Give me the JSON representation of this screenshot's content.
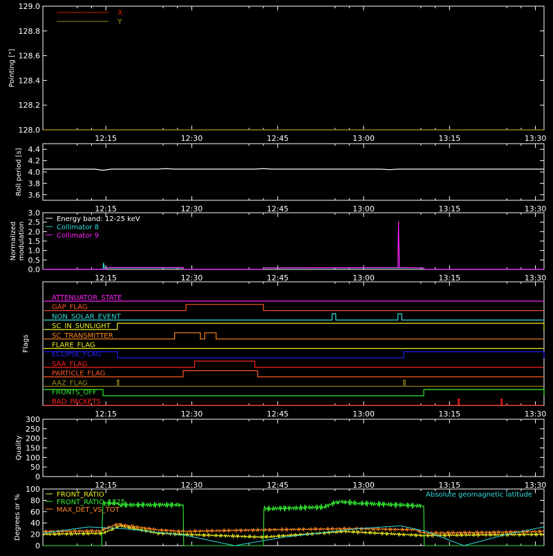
{
  "colors": {
    "background": "#000000",
    "axes": "#ffffff",
    "x_red": "#cc2200",
    "y_olive": "#9a8a20",
    "cyan": "#33dddd",
    "magenta": "#ff22ff",
    "green": "#33ee33",
    "yellow": "#eeee22",
    "orange": "#ff8822"
  },
  "time_axis": {
    "range_minutes": [
      0,
      175
    ],
    "ticks": [
      {
        "label": "12:15",
        "t": 22
      },
      {
        "label": "12:30",
        "t": 52
      },
      {
        "label": "12:45",
        "t": 82
      },
      {
        "label": "13:00",
        "t": 112
      },
      {
        "label": "13:15",
        "t": 142
      },
      {
        "label": "13:30",
        "t": 172
      }
    ]
  },
  "chart_data": [
    {
      "type": "line",
      "ylabel": "Pointing [\"]",
      "ylim": [
        128.0,
        129.0
      ],
      "yticks": [
        "128.0",
        "128.2",
        "128.4",
        "128.6",
        "128.8",
        "129.0"
      ],
      "legend": [
        "X",
        "Y"
      ],
      "series": [
        {
          "name": "X",
          "color": "#cc2200",
          "points": [
            [
              0,
              128.0
            ],
            [
              175,
              128.0
            ]
          ]
        },
        {
          "name": "Y",
          "color": "#9a8a20",
          "points": [
            [
              0,
              128.0
            ],
            [
              175,
              128.0
            ]
          ]
        }
      ]
    },
    {
      "type": "line",
      "ylabel": "Roll period [s]",
      "ylim": [
        3.5,
        4.5
      ],
      "yticks": [
        "3.6",
        "3.8",
        "4.0",
        "4.2",
        "4.4"
      ],
      "series": [
        {
          "color": "#ffffff",
          "points": [
            [
              0,
              4.05
            ],
            [
              18,
              4.05
            ],
            [
              21,
              4.03
            ],
            [
              24,
              4.05
            ],
            [
              40,
              4.05
            ],
            [
              43,
              4.06
            ],
            [
              46,
              4.05
            ],
            [
              74,
              4.05
            ],
            [
              77,
              4.06
            ],
            [
              80,
              4.05
            ],
            [
              118,
              4.05
            ],
            [
              121,
              4.04
            ],
            [
              124,
              4.05
            ],
            [
              175,
              4.05
            ]
          ]
        }
      ]
    },
    {
      "type": "line",
      "ylabel": "Normalized modulation",
      "ylim": [
        0,
        3.0
      ],
      "yticks": [
        "0.0",
        "0.5",
        "1.0",
        "1.5",
        "2.0",
        "2.5",
        "3.0"
      ],
      "legend": [
        "Energy band: 12-25 keV",
        "Collimator 8",
        "Collimator 9"
      ],
      "series": [
        {
          "name": "Collimator 8",
          "color": "#33dddd",
          "points": [
            [
              0,
              0.0
            ],
            [
              21,
              0.0
            ],
            [
              21.2,
              0.35
            ],
            [
              21.5,
              0.05
            ],
            [
              22,
              0.08
            ],
            [
              49,
              0.08
            ],
            [
              49.2,
              0.0
            ],
            [
              77,
              0.0
            ],
            [
              77.2,
              0.08
            ],
            [
              133,
              0.08
            ],
            [
              133.2,
              0.0
            ],
            [
              175,
              0.0
            ]
          ]
        },
        {
          "name": "Collimator 9",
          "color": "#ff22ff",
          "points": [
            [
              0,
              0.0
            ],
            [
              22,
              0.0
            ],
            [
              22.2,
              0.1
            ],
            [
              49,
              0.1
            ],
            [
              49.2,
              0.0
            ],
            [
              77,
              0.0
            ],
            [
              77.2,
              0.08
            ],
            [
              124,
              0.1
            ],
            [
              124.2,
              2.55
            ],
            [
              124.5,
              0.1
            ],
            [
              133,
              0.08
            ],
            [
              133.2,
              0.0
            ],
            [
              175,
              0.0
            ]
          ]
        }
      ]
    },
    {
      "type": "line",
      "ylabel": "Flags",
      "flags": [
        {
          "name": "ATTENUATOR_STATE",
          "color": "#ff22ff",
          "on": []
        },
        {
          "name": "GAP_FLAG",
          "color": "#ff5522",
          "on": [
            [
              50,
              77
            ]
          ]
        },
        {
          "name": "NON_SOLAR_EVENT",
          "color": "#33dddd",
          "on": [
            [
              101,
              102.3
            ],
            [
              124,
              125.3
            ]
          ]
        },
        {
          "name": "SC_IN_SUNLIGHT",
          "color": "#eeee22",
          "on": [
            [
              26,
              175
            ]
          ]
        },
        {
          "name": "SC_TRANSMITTER",
          "color": "#ff8822",
          "on": [
            [
              46,
              55
            ],
            [
              56.5,
              60.5
            ]
          ]
        },
        {
          "name": "FLARE_FLAG",
          "color": "#eeee22",
          "on": []
        },
        {
          "name": "ECLIPSE_FLAG",
          "color": "#2222ff",
          "on": [
            [
              0,
              26
            ],
            [
              126,
              175
            ]
          ]
        },
        {
          "name": "SAA_FLAG",
          "color": "#ff2222",
          "on": [
            [
              53,
              74
            ]
          ]
        },
        {
          "name": "PARTICLE_FLAG",
          "color": "#ff5522",
          "on": [
            [
              49,
              75
            ]
          ]
        },
        {
          "name": "AAZ_FLAG",
          "color": "#9a8a20",
          "on": [
            [
              26,
              26.5
            ],
            [
              126,
              126.5
            ]
          ]
        },
        {
          "name": "FRONTS_OFF",
          "color": "#33ee33",
          "on": [
            [
              0,
              21
            ],
            [
              133,
              175
            ]
          ]
        },
        {
          "name": "BAD_PACKETS",
          "color": "#ff2222",
          "on": [
            [
              145,
              145.4
            ],
            [
              160,
              160.4
            ]
          ]
        }
      ]
    },
    {
      "type": "line",
      "ylabel": "Quality",
      "ylim": [
        0,
        300
      ],
      "yticks": [
        "0",
        "50",
        "100",
        "150",
        "200",
        "250",
        "300"
      ],
      "series": []
    },
    {
      "type": "line",
      "ylabel": "Degrees or %",
      "ylim": [
        0,
        100
      ],
      "yticks": [
        "0",
        "20",
        "40",
        "60",
        "80",
        "100"
      ],
      "legend": [
        "FRONT_RATIO",
        "FRONT_RATIO_1225",
        "MAX_DET_VS_TOT"
      ],
      "annotation": "Absolute geomagnetic latitude",
      "series": [
        {
          "name": "FRONT_RATIO_1225",
          "color": "#33ee33",
          "points": [
            [
              0,
              0
            ],
            [
              20.5,
              0
            ],
            [
              21,
              75
            ],
            [
              26,
              75
            ],
            [
              27,
              72
            ],
            [
              49,
              72
            ],
            [
              49.2,
              0
            ],
            [
              77,
              0
            ],
            [
              77.2,
              65
            ],
            [
              98,
              68
            ],
            [
              103,
              78
            ],
            [
              110,
              75
            ],
            [
              133,
              70
            ],
            [
              133.2,
              0
            ],
            [
              175,
              0
            ]
          ]
        },
        {
          "name": "FRONT_RATIO",
          "color": "#eeee22",
          "points": [
            [
              0,
              20
            ],
            [
              21,
              22
            ],
            [
              27,
              35
            ],
            [
              40,
              22
            ],
            [
              49,
              20
            ],
            [
              77,
              15
            ],
            [
              105,
              25
            ],
            [
              133,
              18
            ],
            [
              175,
              20
            ]
          ]
        },
        {
          "name": "MAX_DET_VS_TOT",
          "color": "#ff8822",
          "points": [
            [
              0,
              25
            ],
            [
              20,
              26
            ],
            [
              26,
              38
            ],
            [
              40,
              28
            ],
            [
              49,
              25
            ],
            [
              77,
              28
            ],
            [
              110,
              30
            ],
            [
              130,
              28
            ],
            [
              133,
              22
            ],
            [
              175,
              25
            ]
          ]
        },
        {
          "name": "Absolute geomagnetic latitude",
          "color": "#33dddd",
          "points": [
            [
              0,
              22
            ],
            [
              16,
              33
            ],
            [
              28,
              30
            ],
            [
              50,
              18
            ],
            [
              67,
              0
            ],
            [
              84,
              15
            ],
            [
              110,
              30
            ],
            [
              125,
              35
            ],
            [
              134,
              25
            ],
            [
              147,
              0
            ],
            [
              162,
              20
            ],
            [
              175,
              33
            ]
          ]
        }
      ]
    }
  ]
}
